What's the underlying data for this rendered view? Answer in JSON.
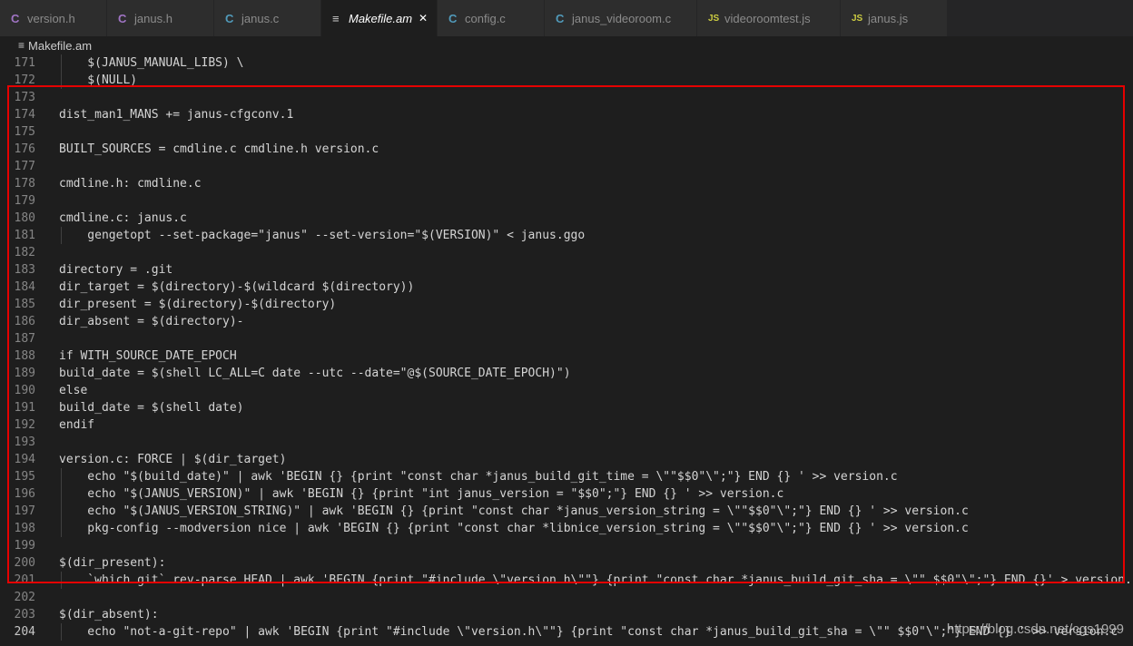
{
  "tabs": [
    {
      "label": "version.h",
      "icon": "C",
      "icon_name": "c-file-icon",
      "active": false
    },
    {
      "label": "janus.h",
      "icon": "C",
      "icon_name": "c-file-icon",
      "active": false
    },
    {
      "label": "janus.c",
      "icon": "C",
      "icon_name": "c-file-icon",
      "active": false
    },
    {
      "label": "Makefile.am",
      "icon": "≡",
      "icon_name": "makefile-icon",
      "active": true
    },
    {
      "label": "config.c",
      "icon": "C",
      "icon_name": "c-file-icon",
      "active": false
    },
    {
      "label": "janus_videoroom.c",
      "icon": "C",
      "icon_name": "c-file-icon",
      "active": false
    },
    {
      "label": "videoroomtest.js",
      "icon": "JS",
      "icon_name": "js-file-icon",
      "active": false
    },
    {
      "label": "janus.js",
      "icon": "JS",
      "icon_name": "js-file-icon",
      "active": false
    }
  ],
  "close_glyph": "✕",
  "breadcrumb": {
    "icon": "≡",
    "label": "Makefile.am"
  },
  "lines": [
    {
      "n": "171",
      "text": "    $(JANUS_MANUAL_LIBS) \\"
    },
    {
      "n": "172",
      "text": "    $(NULL)"
    },
    {
      "n": "173",
      "text": ""
    },
    {
      "n": "174",
      "text": "dist_man1_MANS += janus-cfgconv.1"
    },
    {
      "n": "175",
      "text": ""
    },
    {
      "n": "176",
      "text": "BUILT_SOURCES = cmdline.c cmdline.h version.c"
    },
    {
      "n": "177",
      "text": ""
    },
    {
      "n": "178",
      "text": "cmdline.h: cmdline.c"
    },
    {
      "n": "179",
      "text": ""
    },
    {
      "n": "180",
      "text": "cmdline.c: janus.c"
    },
    {
      "n": "181",
      "text": "    gengetopt --set-package=\"janus\" --set-version=\"$(VERSION)\" < janus.ggo"
    },
    {
      "n": "182",
      "text": ""
    },
    {
      "n": "183",
      "text": "directory = .git"
    },
    {
      "n": "184",
      "text": "dir_target = $(directory)-$(wildcard $(directory))"
    },
    {
      "n": "185",
      "text": "dir_present = $(directory)-$(directory)"
    },
    {
      "n": "186",
      "text": "dir_absent = $(directory)-"
    },
    {
      "n": "187",
      "text": ""
    },
    {
      "n": "188",
      "text": "if WITH_SOURCE_DATE_EPOCH"
    },
    {
      "n": "189",
      "text": "build_date = $(shell LC_ALL=C date --utc --date=\"@$(SOURCE_DATE_EPOCH)\")"
    },
    {
      "n": "190",
      "text": "else"
    },
    {
      "n": "191",
      "text": "build_date = $(shell date)"
    },
    {
      "n": "192",
      "text": "endif"
    },
    {
      "n": "193",
      "text": ""
    },
    {
      "n": "194",
      "text": "version.c: FORCE | $(dir_target)"
    },
    {
      "n": "195",
      "text": "    echo \"$(build_date)\" | awk 'BEGIN {} {print \"const char *janus_build_git_time = \\\"\"$$0\"\\\";\"} END {} ' >> version.c"
    },
    {
      "n": "196",
      "text": "    echo \"$(JANUS_VERSION)\" | awk 'BEGIN {} {print \"int janus_version = \"$$0\";\"} END {} ' >> version.c"
    },
    {
      "n": "197",
      "text": "    echo \"$(JANUS_VERSION_STRING)\" | awk 'BEGIN {} {print \"const char *janus_version_string = \\\"\"$$0\"\\\";\"} END {} ' >> version.c"
    },
    {
      "n": "198",
      "text": "    pkg-config --modversion nice | awk 'BEGIN {} {print \"const char *libnice_version_string = \\\"\"$$0\"\\\";\"} END {} ' >> version.c"
    },
    {
      "n": "199",
      "text": ""
    },
    {
      "n": "200",
      "text": "$(dir_present):"
    },
    {
      "n": "201",
      "text": "    `which git` rev-parse HEAD | awk 'BEGIN {print \"#include \\\"version.h\\\"\"} {print \"const char *janus_build_git_sha = \\\"\" $$0\"\\\";\"} END {}' > version.c"
    },
    {
      "n": "202",
      "text": ""
    },
    {
      "n": "203",
      "text": "$(dir_absent):"
    },
    {
      "n": "204",
      "text": "    echo \"not-a-git-repo\" | awk 'BEGIN {print \"#include \\\"version.h\\\"\"} {print \"const char *janus_build_git_sha = \\\"\" $$0\"\\\";\"} END {} ' >> version.c"
    }
  ],
  "watermark": "https://blog.csdn.net/cgs1999"
}
